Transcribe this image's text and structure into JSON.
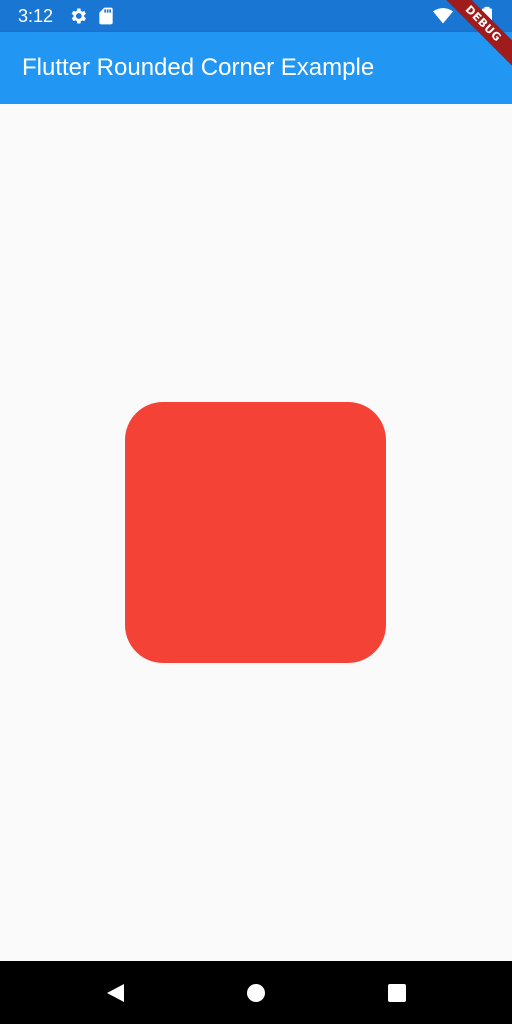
{
  "status_bar": {
    "time": "3:12",
    "icons": [
      "settings-icon",
      "sd-card-icon",
      "wifi-icon",
      "battery-icon"
    ],
    "background_color": "#1976d2"
  },
  "app_bar": {
    "title": "Flutter Rounded Corner Example",
    "background_color": "#2196f3"
  },
  "debug_banner": {
    "label": "DEBUG",
    "color": "#a01b1b"
  },
  "content": {
    "box_color": "#f44336",
    "background_color": "#fafafa"
  },
  "nav_bar": {
    "buttons": [
      "back-icon",
      "home-icon",
      "recents-icon"
    ]
  }
}
